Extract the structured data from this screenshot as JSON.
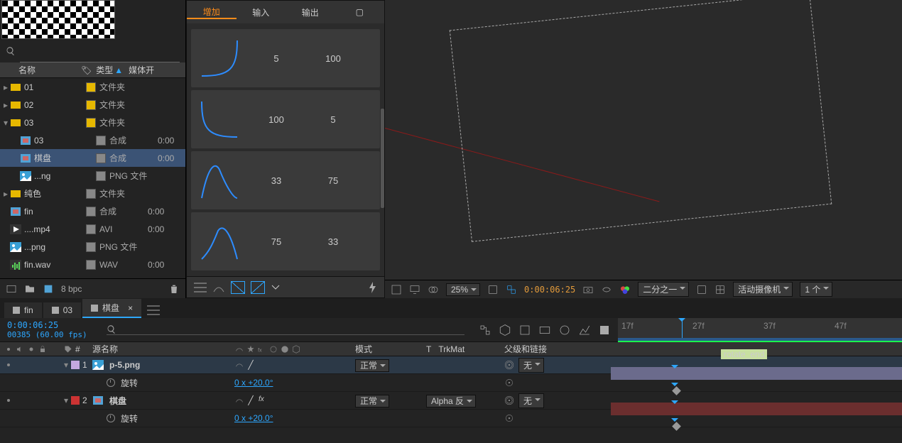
{
  "project": {
    "search_placeholder": "",
    "columns": {
      "name": "名称",
      "type": "类型",
      "sort_icon": "▲",
      "media": "媒体开"
    },
    "bpc": "8 bpc",
    "tag_icon": "🏷",
    "items": [
      {
        "name": "01",
        "type": "文件夹",
        "kind": "folder",
        "swatch": "#e6b800",
        "expand": "▸",
        "dur": ""
      },
      {
        "name": "02",
        "type": "文件夹",
        "kind": "folder",
        "swatch": "#e6b800",
        "expand": "▸",
        "dur": ""
      },
      {
        "name": "03",
        "type": "文件夹",
        "kind": "folder",
        "swatch": "#e6b800",
        "expand": "▾",
        "dur": ""
      },
      {
        "name": "03",
        "type": "合成",
        "kind": "comp",
        "swatch": "#888",
        "indent": 1,
        "dur": "0:00"
      },
      {
        "name": "棋盘",
        "type": "合成",
        "kind": "comp",
        "swatch": "#888",
        "indent": 1,
        "sel": true,
        "dur": "0:00"
      },
      {
        "name": "...ng",
        "type": "PNG 文件",
        "kind": "png",
        "swatch": "#888",
        "indent": 1,
        "dur": ""
      },
      {
        "name": "纯色",
        "type": "文件夹",
        "kind": "folder",
        "swatch": "#888",
        "expand": "▸",
        "dur": ""
      },
      {
        "name": "fin",
        "type": "合成",
        "kind": "comp",
        "swatch": "#888",
        "dur": "0:00"
      },
      {
        "name": "....mp4",
        "type": "AVI",
        "kind": "vid",
        "swatch": "#888",
        "dur": "0:00"
      },
      {
        "name": "...png",
        "type": "PNG 文件",
        "kind": "png",
        "swatch": "#888",
        "dur": ""
      },
      {
        "name": "fin.wav",
        "type": "WAV",
        "kind": "aud",
        "swatch": "#888",
        "dur": "0:00"
      }
    ]
  },
  "easing": {
    "tabs": {
      "add": "增加",
      "in": "输入",
      "out": "输出",
      "box": "▢"
    },
    "rows": [
      {
        "in": "5",
        "out": "100",
        "curve": "ease-in"
      },
      {
        "in": "100",
        "out": "5",
        "curve": "ease-out"
      },
      {
        "in": "33",
        "out": "75",
        "curve": "peak-l"
      },
      {
        "in": "75",
        "out": "33",
        "curve": "peak-r"
      }
    ]
  },
  "viewer": {
    "zoom": "25%",
    "timecode": "0:00:06:25",
    "resolution": "二分之一",
    "camera": "活动摄像机",
    "views": "1 个"
  },
  "timeline": {
    "tabs": [
      {
        "label": "fin"
      },
      {
        "label": "03"
      },
      {
        "label": "棋盘",
        "active": true,
        "close": "×"
      }
    ],
    "timecode": "0:00:06:25",
    "frames": "00385 (60.00 fps)",
    "ruler": [
      "17f",
      "27f",
      "37f",
      "47f"
    ],
    "marker": "rotate_end",
    "cols": {
      "eye": "",
      "tag": "#",
      "source": "源名称",
      "switches": "",
      "mode": "模式",
      "t": "T",
      "trkmat": "TrkMat",
      "parent": "父级和链接"
    },
    "layers": [
      {
        "num": "1",
        "swatch": "#c4a8e0",
        "name": "p-5.png",
        "mode": "正常",
        "trk": "",
        "parent": "无",
        "rot_label": "旋转",
        "rot_val": "0 x +20.0°",
        "sel": true,
        "bar": "purple",
        "icon": "png"
      },
      {
        "num": "2",
        "swatch": "#c33",
        "name": "棋盘",
        "mode": "正常",
        "trk": "Alpha 反",
        "parent": "无",
        "rot_label": "旋转",
        "rot_val": "0 x +20.0°",
        "bar": "red",
        "icon": "comp",
        "fx": true
      }
    ]
  }
}
